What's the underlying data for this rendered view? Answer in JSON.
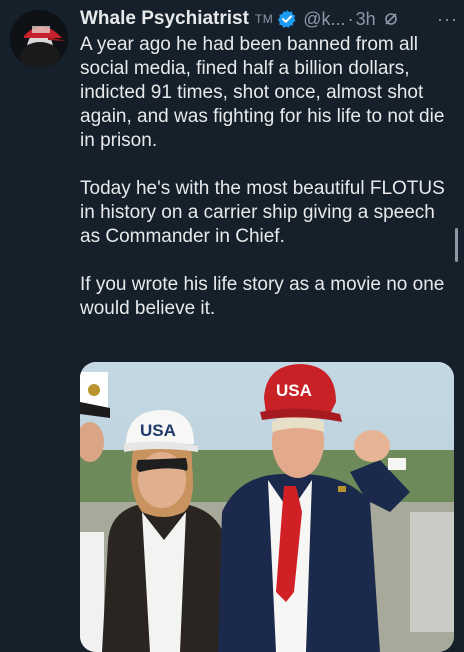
{
  "author": {
    "display_name": "Whale Psychiatrist",
    "badge": "TM",
    "handle": "@k...",
    "separator": "·",
    "time": "3h"
  },
  "icons": {
    "verified": "verified-badge-icon",
    "grok": "grok-icon",
    "more": "more-options-icon"
  },
  "colors": {
    "background": "#15202b",
    "text": "#e7e9ea",
    "muted": "#8b98a5",
    "verified_blue": "#1d9bf0"
  },
  "tweet": {
    "paragraphs": [
      "A year ago he had been banned from all social media, fined half a billion dollars, indicted 91 times, shot once, almost shot again, and was fighting for his life to not die in prison.",
      "Today he's with the most beautiful FLOTUS in history on a carrier ship giving a speech as Commander in Chief.",
      "If you wrote his life story as a movie no one would believe it."
    ]
  },
  "media": {
    "cap_left": "USA",
    "cap_right": "USA"
  },
  "more_symbol": "···"
}
